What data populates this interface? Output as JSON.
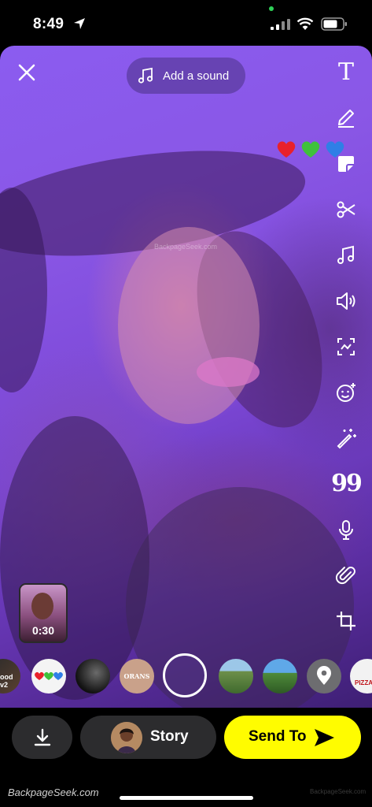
{
  "status_bar": {
    "time": "8:49",
    "icons": [
      "location-arrow-icon",
      "camera-in-use-dot",
      "signal-icon",
      "wifi-icon",
      "battery-icon"
    ]
  },
  "top_bar": {
    "close_icon": "close-icon",
    "sound_button": {
      "icon": "music-note-icon",
      "label": "Add a sound"
    }
  },
  "right_toolbar": [
    {
      "name": "text-tool",
      "icon": "text-icon",
      "glyph": "T"
    },
    {
      "name": "draw-tool",
      "icon": "pencil-icon"
    },
    {
      "name": "sticker-tool",
      "icon": "sticker-icon"
    },
    {
      "name": "scissors-tool",
      "icon": "scissors-icon"
    },
    {
      "name": "music-tool",
      "icon": "music-note-icon"
    },
    {
      "name": "volume-tool",
      "icon": "speaker-icon"
    },
    {
      "name": "crop-frame-tool",
      "icon": "frame-icon"
    },
    {
      "name": "emoji-tool",
      "icon": "smiley-plus-icon"
    },
    {
      "name": "magic-tool",
      "icon": "magic-wand-icon"
    },
    {
      "name": "quote-tool",
      "icon": "quote-icon",
      "glyph": "99"
    },
    {
      "name": "voice-tool",
      "icon": "microphone-icon"
    },
    {
      "name": "attach-tool",
      "icon": "paperclip-icon"
    },
    {
      "name": "crop-tool",
      "icon": "crop-icon"
    }
  ],
  "hearts_sticker": [
    "❤️",
    "💚",
    "💙"
  ],
  "preview": {
    "watermark": "BackpageSeek.com"
  },
  "memory_thumbnail": {
    "duration": "0:30"
  },
  "lenses": [
    {
      "name": "lens-partial",
      "label": "ood\nv2"
    },
    {
      "name": "lens-hearts",
      "label": ""
    },
    {
      "name": "lens-dark-photo",
      "label": ""
    },
    {
      "name": "lens-brand",
      "label": "ORANS"
    },
    {
      "name": "lens-landscape-1",
      "label": ""
    },
    {
      "name": "lens-landscape-2",
      "label": ""
    },
    {
      "name": "lens-location",
      "label": ""
    },
    {
      "name": "lens-pizza",
      "label": "PIZZA"
    }
  ],
  "bottom_bar": {
    "save_icon": "download-icon",
    "story_label": "Story",
    "send_label": "Send To",
    "send_icon": "send-arrow-icon",
    "accent_color": "#fffc00"
  },
  "watermarks": {
    "brand": "BackpageSeek.com",
    "small": "BackpageSeek.com"
  }
}
